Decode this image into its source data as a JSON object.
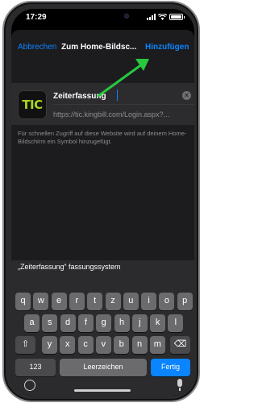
{
  "status_bar": {
    "time": "17:29"
  },
  "navbar": {
    "cancel_label": "Abbrechen",
    "title": "Zum Home-Bildsc...",
    "add_label": "Hinzufügen"
  },
  "annotation": {
    "color": "#27c93f",
    "icon": "arrow-icon"
  },
  "bookmark": {
    "app_icon_text": "TIC",
    "name_value": "Zeiterfassung",
    "url": "https://tic.kingbill.com/Login.aspx?..."
  },
  "hint_text": "Für schnellen Zugriff auf diese Website wird auf deinem Home-Bildschirm ein Symbol hinzugefügt.",
  "keyboard": {
    "suggestion": "„Zeiterfassung“ fassungssystem",
    "rows": [
      [
        "q",
        "w",
        "e",
        "r",
        "t",
        "z",
        "u",
        "i",
        "o",
        "p"
      ],
      [
        "a",
        "s",
        "d",
        "f",
        "g",
        "h",
        "j",
        "k",
        "l"
      ],
      [
        "y",
        "x",
        "c",
        "v",
        "b",
        "n",
        "m"
      ]
    ],
    "shift_key": "⇧",
    "delete_key": "⌫",
    "numbers_key": "123",
    "space_key": "Leerzeichen",
    "return_key": "Fertig"
  },
  "colors": {
    "accent": "#0a84ff",
    "background": "#1c1c1e"
  }
}
